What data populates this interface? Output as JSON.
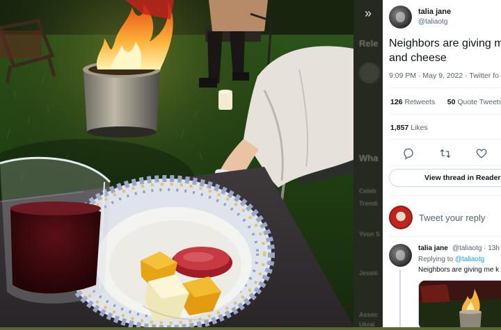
{
  "viewer": {
    "expand_icon": "double-chevron-right-icon",
    "background_ghost_texts": [
      "Rele",
      "Wha",
      "Celeb",
      "Trendi",
      "Yvon S",
      "Jessic",
      "Assoc",
      "Ukrai"
    ]
  },
  "tweet": {
    "author_name": "talia jane",
    "author_handle": "@taliaotg",
    "text_line1": "Neighbors are giving m",
    "text_line2": "and cheese",
    "timestamp": "9:09 PM · May 9, 2022 · Twitter fo",
    "retweets_count": "126",
    "retweets_label": "Retweets",
    "quote_count": "50",
    "quote_label": "Quote Tweets",
    "likes_count": "1,857",
    "likes_label": "Likes",
    "actions": [
      "reply-icon",
      "retweet-icon",
      "like-icon"
    ],
    "view_thread_label": "View thread in Reader"
  },
  "reply_box": {
    "placeholder": "Tweet your reply"
  },
  "reply": {
    "author_name": "talia jane",
    "handle_time": "@taliaotg · 13h",
    "replying_prefix": "Replying to",
    "replying_to": "@taliaotg",
    "text": "Neighbors are giving me k"
  },
  "colors": {
    "accent": "#1d9bf0",
    "panel_bg": "#ffffff",
    "secondary_text": "#536471"
  }
}
